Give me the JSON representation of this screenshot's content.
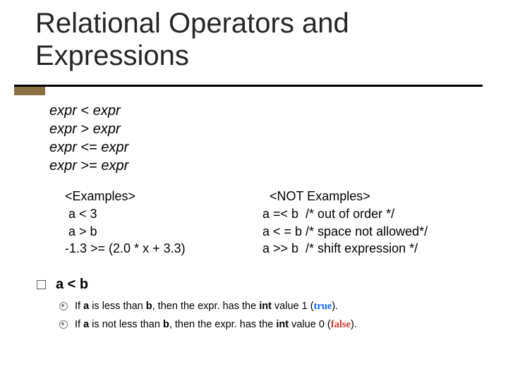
{
  "title": "Relational Operators and Expressions",
  "ops": {
    "lt": {
      "lhs": "expr",
      "sym": "<",
      "rhs": "expr"
    },
    "gt": {
      "lhs": "expr",
      "sym": ">",
      "rhs": "expr"
    },
    "le": {
      "lhs": "expr",
      "sym": "<=",
      "rhs": "expr"
    },
    "ge": {
      "lhs": "expr",
      "sym": ">=",
      "rhs": "expr"
    }
  },
  "examples": {
    "left_title": "<Examples>",
    "left": {
      "l1": " a < 3",
      "l2": " a > b",
      "l3": "-1.3 >= (2.0 * x + 3.3)"
    },
    "right_title": "  <NOT Examples>",
    "right": {
      "r1": "a =< b  /* out of order */",
      "r2": "a < = b /* space not allowed*/",
      "r3": "a >> b  /* shift expression */"
    }
  },
  "ab": {
    "header": "a < b",
    "sub1_pre": "If ",
    "sub1_a": "a",
    "sub1_mid": " is less than ",
    "sub1_b": "b",
    "sub1_post1": ", then the expr. has the ",
    "sub1_bold": "int",
    "sub1_post2": " value 1 (",
    "sub1_kw": "true",
    "sub1_end": ").",
    "sub2_pre": "If ",
    "sub2_a": "a",
    "sub2_mid": " is not less than ",
    "sub2_b": "b",
    "sub2_post1": ", then the expr. has the ",
    "sub2_bold": "int",
    "sub2_post2": " value 0 (",
    "sub2_kw": "false",
    "sub2_end": ")."
  }
}
